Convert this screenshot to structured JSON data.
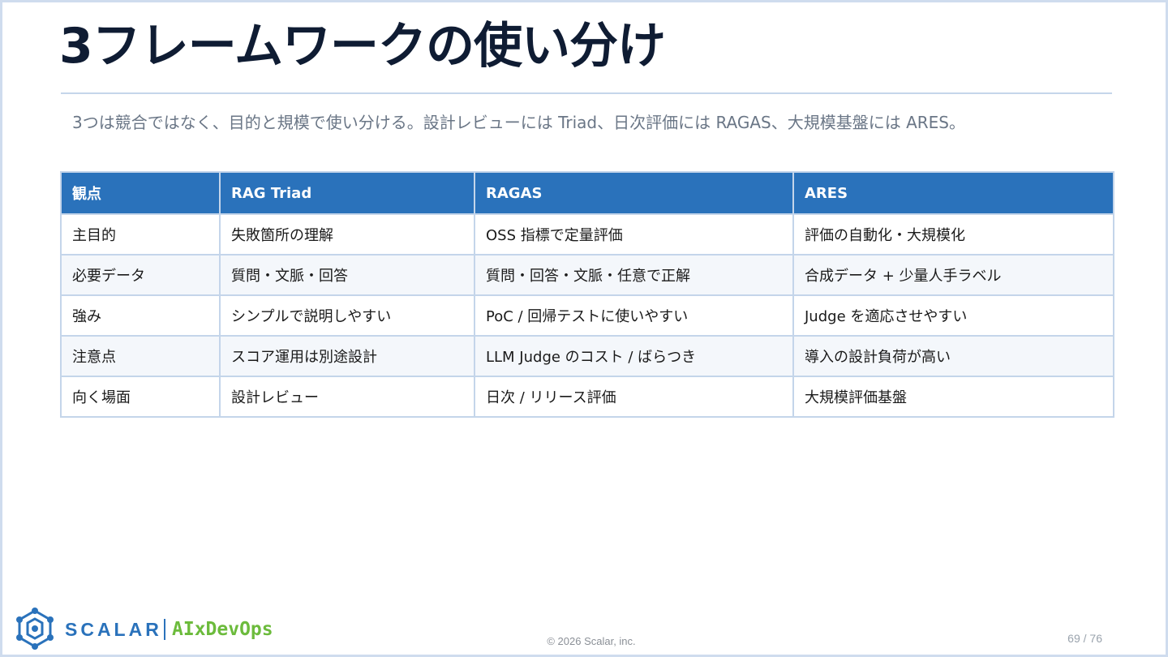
{
  "slide": {
    "title": "3フレームワークの使い分け",
    "subtitle": "3つは競合ではなく、目的と規模で使い分ける。設計レビューには Triad、日次評価には RAGAS、大規模基盤には ARES。"
  },
  "table": {
    "headers": [
      "観点",
      "RAG Triad",
      "RAGAS",
      "ARES"
    ],
    "rows": [
      [
        "主目的",
        "失敗箇所の理解",
        "OSS 指標で定量評価",
        "評価の自動化・大規模化"
      ],
      [
        "必要データ",
        "質問・文脈・回答",
        "質問・回答・文脈・任意で正解",
        "合成データ + 少量人手ラベル"
      ],
      [
        "強み",
        "シンプルで説明しやすい",
        "PoC / 回帰テストに使いやすい",
        "Judge を適応させやすい"
      ],
      [
        "注意点",
        "スコア運用は別途設計",
        "LLM Judge のコスト / ばらつき",
        "導入の設計負荷が高い"
      ],
      [
        "向く場面",
        "設計レビュー",
        "日次 / リリース評価",
        "大規模評価基盤"
      ]
    ]
  },
  "footer": {
    "brand": "SCALAR",
    "product": "AIxDevOps",
    "copyright": "© 2026 Scalar, inc.",
    "page": "69 / 76",
    "logo_icon": "scalar-logo-icon"
  },
  "colors": {
    "header_bg": "#2a72bb",
    "brand_blue": "#2a72bb",
    "brand_green": "#6cbb3c",
    "title": "#0f1c33"
  }
}
